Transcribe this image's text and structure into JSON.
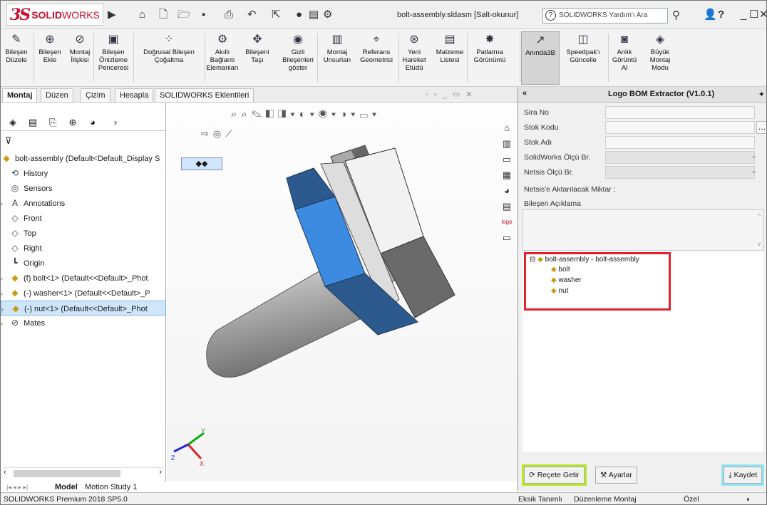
{
  "window": {
    "brand_prefix": "SOLID",
    "brand_suffix": "WORKS",
    "document_title": "bolt-assembly.sldasm [Salt-okunur]",
    "help_search_placeholder": "SOLIDWORKS Yardım'ı Ara"
  },
  "ribbon": [
    {
      "l1": "Bileşen",
      "l2": "Düzele",
      "l3": "",
      "icon": "edit-component-icon"
    },
    {
      "l1": "Bileşen",
      "l2": "Ekle",
      "l3": "",
      "icon": "insert-component-icon"
    },
    {
      "l1": "Montaj",
      "l2": "İlişkisi",
      "l3": "",
      "icon": "mate-icon"
    },
    {
      "l1": "Bileşen",
      "l2": "Önizleme",
      "l3": "Penceresi",
      "icon": "preview-window-icon"
    },
    {
      "l1": "Doğrusal Bileşen",
      "l2": "Çoğaltma",
      "l3": "",
      "icon": "linear-pattern-icon"
    },
    {
      "l1": "Akıllı",
      "l2": "Bağlantı",
      "l3": "Elemanları",
      "icon": "smart-fastener-icon"
    },
    {
      "l1": "Bileşeni",
      "l2": "Taşı",
      "l3": "",
      "icon": "move-component-icon"
    },
    {
      "l1": "Gizli",
      "l2": "Bileşenleri",
      "l3": "göster",
      "icon": "show-hidden-icon"
    },
    {
      "l1": "Montaj",
      "l2": "Unsurları",
      "l3": "",
      "icon": "assembly-features-icon"
    },
    {
      "l1": "Referans",
      "l2": "Geometrisi",
      "l3": "",
      "icon": "reference-geometry-icon"
    },
    {
      "l1": "Yeni",
      "l2": "Hareket",
      "l3": "Etüdü",
      "icon": "motion-study-icon"
    },
    {
      "l1": "Malzeme",
      "l2": "Listesi",
      "l3": "",
      "icon": "bom-icon"
    },
    {
      "l1": "Patlatma",
      "l2": "Görünümü",
      "l3": "",
      "icon": "exploded-view-icon"
    },
    {
      "l1": "Anında3B",
      "l2": "",
      "l3": "",
      "icon": "instant3d-icon"
    },
    {
      "l1": "Speedpak'ı",
      "l2": "Güncelle",
      "l3": "",
      "icon": "speedpak-icon"
    },
    {
      "l1": "Anlık",
      "l2": "Görüntü",
      "l3": "Al",
      "icon": "snapshot-icon"
    },
    {
      "l1": "Büyük",
      "l2": "Montaj",
      "l3": "Modu",
      "icon": "large-assembly-icon"
    }
  ],
  "tabs": [
    "Montaj",
    "Düzen",
    "Çizim",
    "Hesapla",
    "SOLIDWORKS Eklentileri"
  ],
  "tree": {
    "root": "bolt-assembly  (Default<Default_Display S",
    "items": [
      {
        "label": "History",
        "icon": "history-folder-icon"
      },
      {
        "label": "Sensors",
        "icon": "sensors-folder-icon"
      },
      {
        "label": "Annotations",
        "icon": "annotations-icon"
      },
      {
        "label": "Front",
        "icon": "plane-icon"
      },
      {
        "label": "Top",
        "icon": "plane-icon"
      },
      {
        "label": "Right",
        "icon": "plane-icon"
      },
      {
        "label": "Origin",
        "icon": "origin-icon"
      },
      {
        "label": "(f) bolt<1> (Default<<Default>_Phot",
        "icon": "part-icon"
      },
      {
        "label": "(-) washer<1> (Default<<Default>_P",
        "icon": "part-icon"
      },
      {
        "label": "(-) nut<1> (Default<<Default>_Phot",
        "icon": "part-icon"
      },
      {
        "label": "Mates",
        "icon": "mates-icon"
      }
    ]
  },
  "bottom_tabs": [
    "Model",
    "Motion Study 1"
  ],
  "panel": {
    "title": "Logo BOM Extractor (V1.0.1)",
    "fields": [
      {
        "label": "Sira No"
      },
      {
        "label": "Stok Kodu"
      },
      {
        "label": "Stok Adı"
      },
      {
        "label": "SolidWorks Ölçü Br."
      },
      {
        "label": "Netsis Ölçü Br."
      }
    ],
    "transfer_qty_label": "Netsis'e Aktarılacak Miktar :",
    "description_label": "Bileşen Açıklama",
    "bom_root": "bolt-assembly - bolt-assembly",
    "bom_children": [
      "bolt",
      "washer",
      "nut"
    ],
    "get_recipe_button": "Reçete Getir",
    "settings_button": "Ayarlar",
    "save_button": "Kaydet"
  },
  "status": {
    "product": "SOLIDWORKS Premium 2018 SP5.0",
    "defined": "Eksik Tanımlı",
    "mode": "Düzenleme Montaj",
    "units": "Özel"
  },
  "colors": {
    "accent_red": "#c8102e",
    "part_blue": "#3d8be0",
    "highlight_green": "#b9e626",
    "highlight_cyan": "#8fe6f2",
    "bom_frame_red": "#e0202a"
  }
}
